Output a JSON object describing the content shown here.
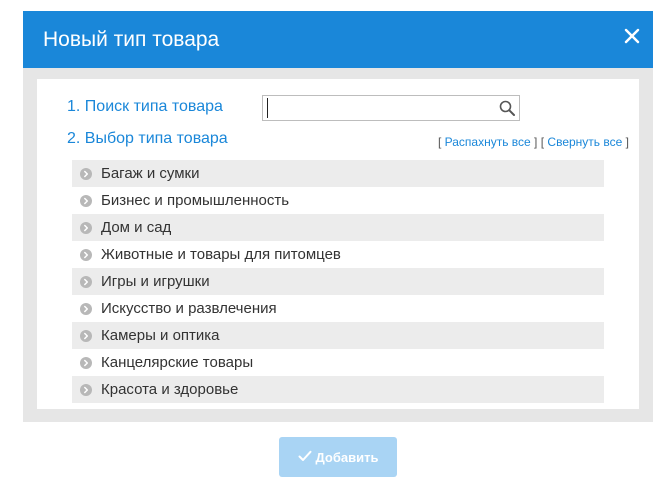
{
  "dialog": {
    "title": "Новый тип товара",
    "close_icon": "close-icon"
  },
  "steps": {
    "search_label": "1. Поиск типа товара",
    "select_label": "2. Выбор типа товара"
  },
  "search": {
    "value": "",
    "placeholder": "",
    "icon": "search-icon"
  },
  "tree_controls": {
    "open_bracket_1": "[",
    "expand_all": "Распахнуть все",
    "close_bracket_1": "]",
    "open_bracket_2": "[",
    "collapse_all": "Свернуть все",
    "close_bracket_2": "]"
  },
  "categories": [
    {
      "label": "Багаж и сумки"
    },
    {
      "label": "Бизнес и промышленность"
    },
    {
      "label": "Дом и сад"
    },
    {
      "label": "Животные и товары для питомцев"
    },
    {
      "label": "Игры и игрушки"
    },
    {
      "label": "Искусство и развлечения"
    },
    {
      "label": "Камеры и оптика"
    },
    {
      "label": "Канцелярские товары"
    },
    {
      "label": "Красота и здоровье"
    }
  ],
  "footer": {
    "add_label": "Добавить",
    "add_icon": "check-icon"
  },
  "colors": {
    "header": "#1a87d9",
    "accent": "#1a87d9",
    "button_disabled": "#a9d4f4",
    "row_stripe": "#ececec"
  }
}
